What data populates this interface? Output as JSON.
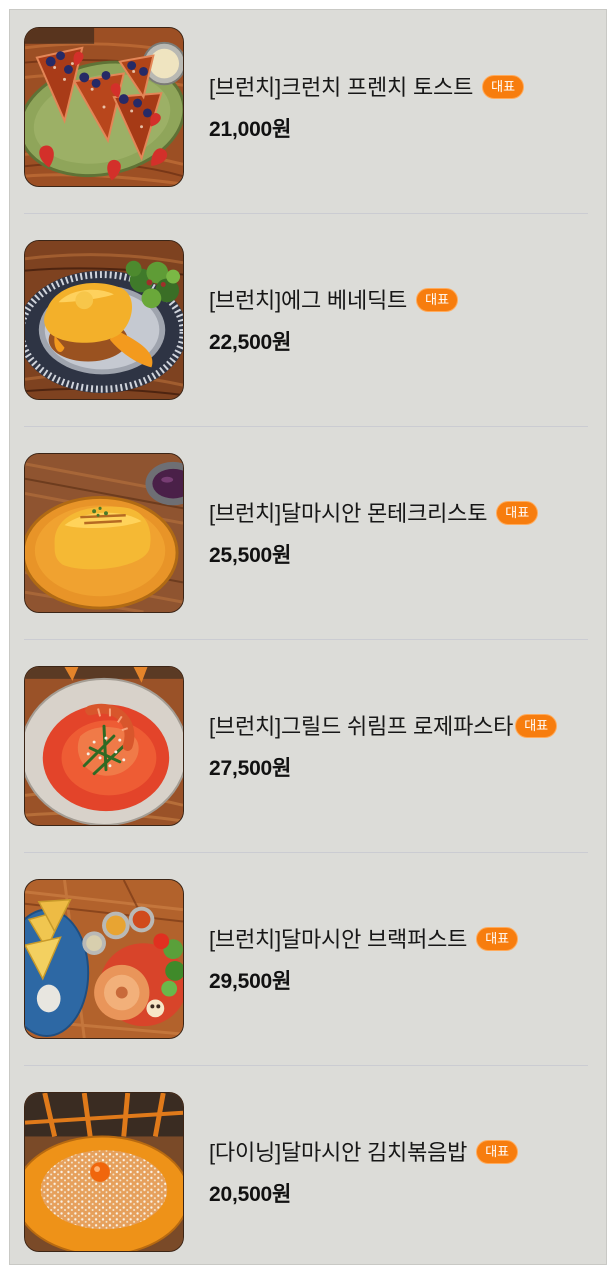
{
  "menu": {
    "items": [
      {
        "name": "[브런치]크런치 프렌치 토스트",
        "badge": "대표",
        "price": "21,000원"
      },
      {
        "name": "[브런치]에그 베네딕트",
        "badge": "대표",
        "price": "22,500원"
      },
      {
        "name": "[브런치]달마시안 몬테크리스토",
        "badge": "대표",
        "price": "25,500원"
      },
      {
        "name": "[브런치]그릴드 쉬림프 로제파스타",
        "badge": "대표",
        "price": "27,500원"
      },
      {
        "name": "[브런치]달마시안 브랙퍼스트",
        "badge": "대표",
        "price": "29,500원"
      },
      {
        "name": "[다이닝]달마시안 김치볶음밥",
        "badge": "대표",
        "price": "20,500원"
      }
    ]
  },
  "colors": {
    "background": "#dcdcd8",
    "badge": "#f77d0e",
    "divider": "#cbccd2",
    "text": "#171717"
  }
}
